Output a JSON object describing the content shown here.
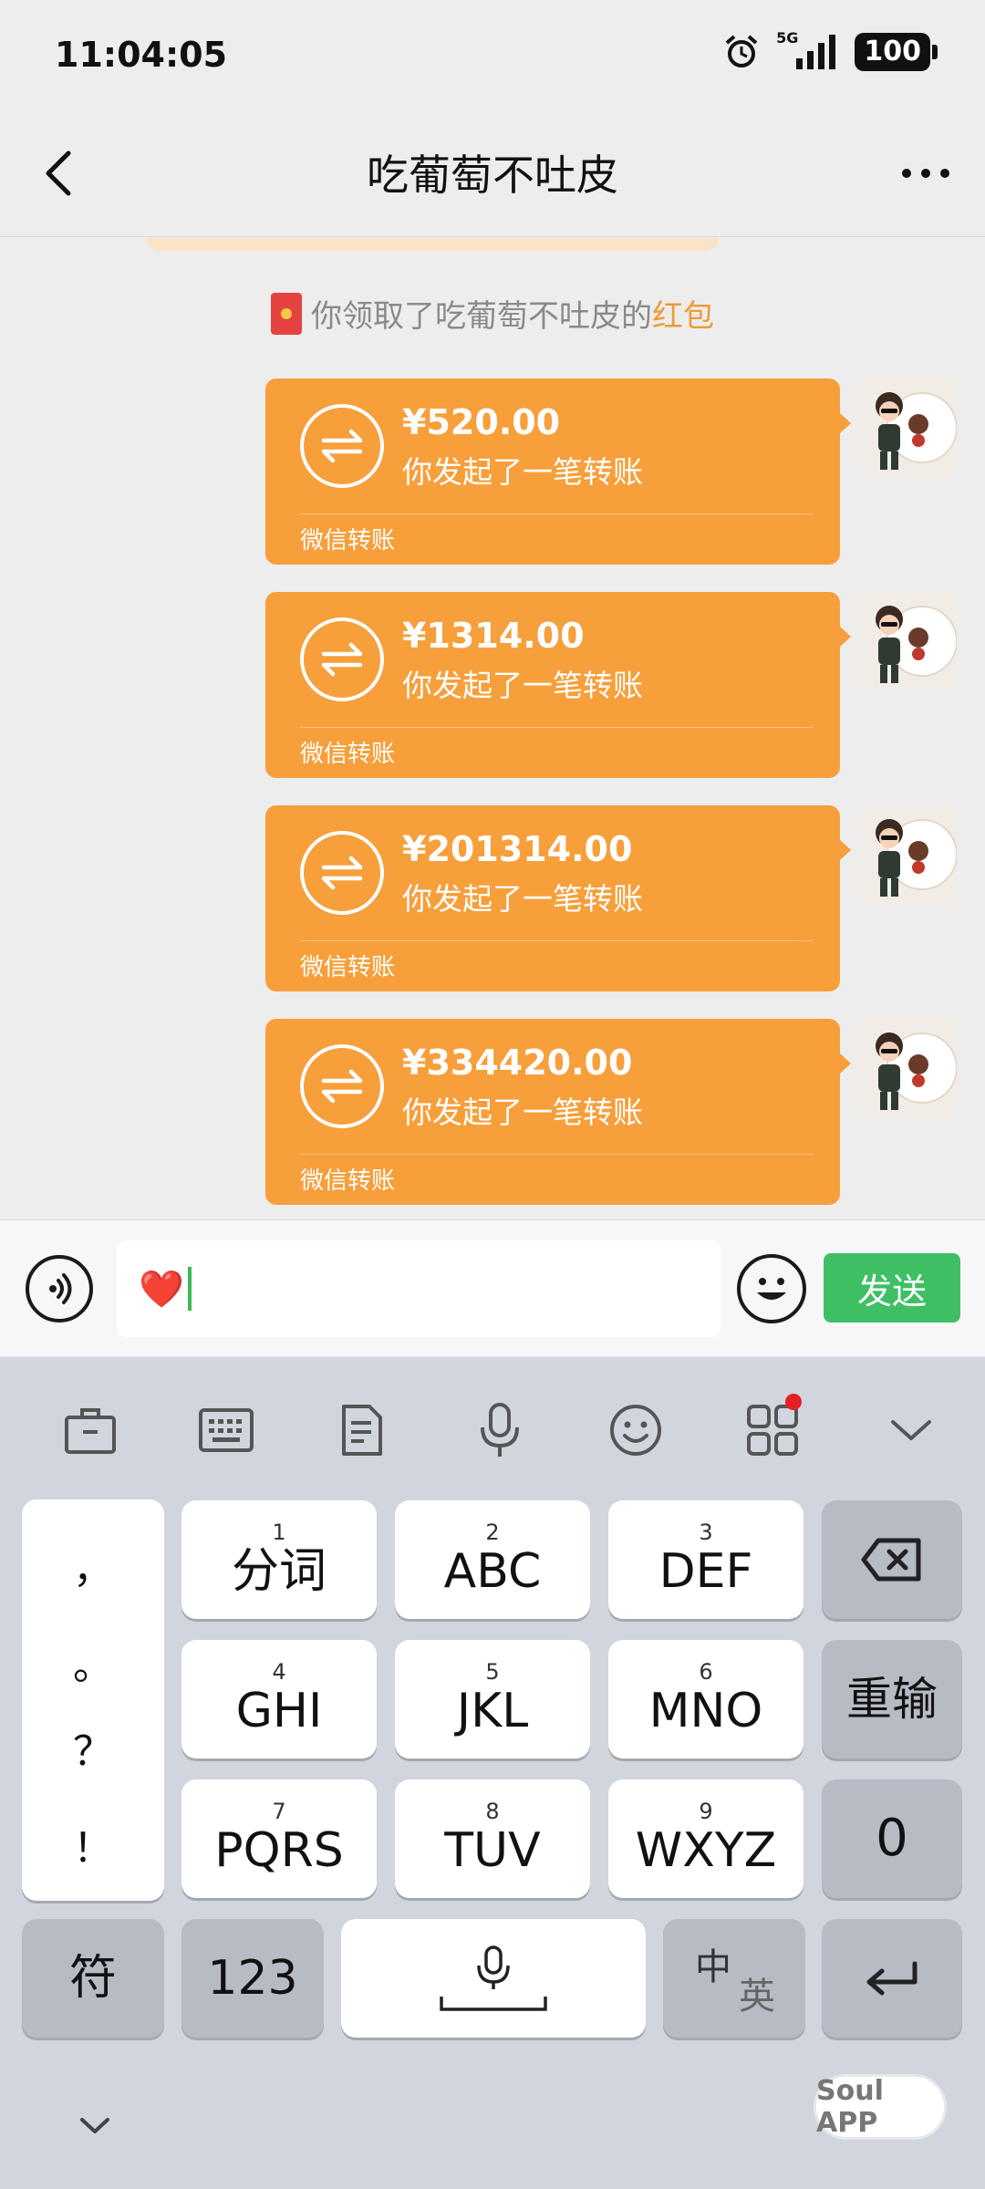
{
  "status_bar": {
    "time": "11:04:05",
    "network": "5G",
    "battery": "100"
  },
  "header": {
    "title": "吃葡萄不吐皮"
  },
  "system_notice": {
    "prefix": "你领取了吃葡萄不吐皮的",
    "link": "红包"
  },
  "transfers": [
    {
      "amount": "¥520.00",
      "description": "你发起了一笔转账",
      "footer": "微信转账"
    },
    {
      "amount": "¥1314.00",
      "description": "你发起了一笔转账",
      "footer": "微信转账"
    },
    {
      "amount": "¥201314.00",
      "description": "你发起了一笔转账",
      "footer": "微信转账"
    },
    {
      "amount": "¥334420.00",
      "description": "你发起了一笔转账",
      "footer": "微信转账"
    }
  ],
  "input": {
    "value": "❤️",
    "send_label": "发送"
  },
  "keyboard": {
    "toolbar": [
      "briefcase-icon",
      "keyboard-icon",
      "clipboard-icon",
      "microphone-icon",
      "emoji-icon",
      "apps-icon",
      "chevron-down-icon"
    ],
    "punctuation": [
      "，",
      "。",
      "？",
      "！"
    ],
    "keys": [
      {
        "num": "1",
        "label": "分词"
      },
      {
        "num": "2",
        "label": "ABC"
      },
      {
        "num": "3",
        "label": "DEF"
      },
      {
        "num": "4",
        "label": "GHI"
      },
      {
        "num": "5",
        "label": "JKL"
      },
      {
        "num": "6",
        "label": "MNO"
      },
      {
        "num": "7",
        "label": "PQRS"
      },
      {
        "num": "8",
        "label": "TUV"
      },
      {
        "num": "9",
        "label": "WXYZ"
      }
    ],
    "reenter_label": "重输",
    "zero_label": "0",
    "symbol_label": "符",
    "numbers_label": "123",
    "lang_top": "中",
    "lang_bottom": "英"
  },
  "watermark": "Soul APP",
  "colors": {
    "transfer": "#f79f3b",
    "send": "#3fbf64",
    "link": "#f09a37"
  }
}
